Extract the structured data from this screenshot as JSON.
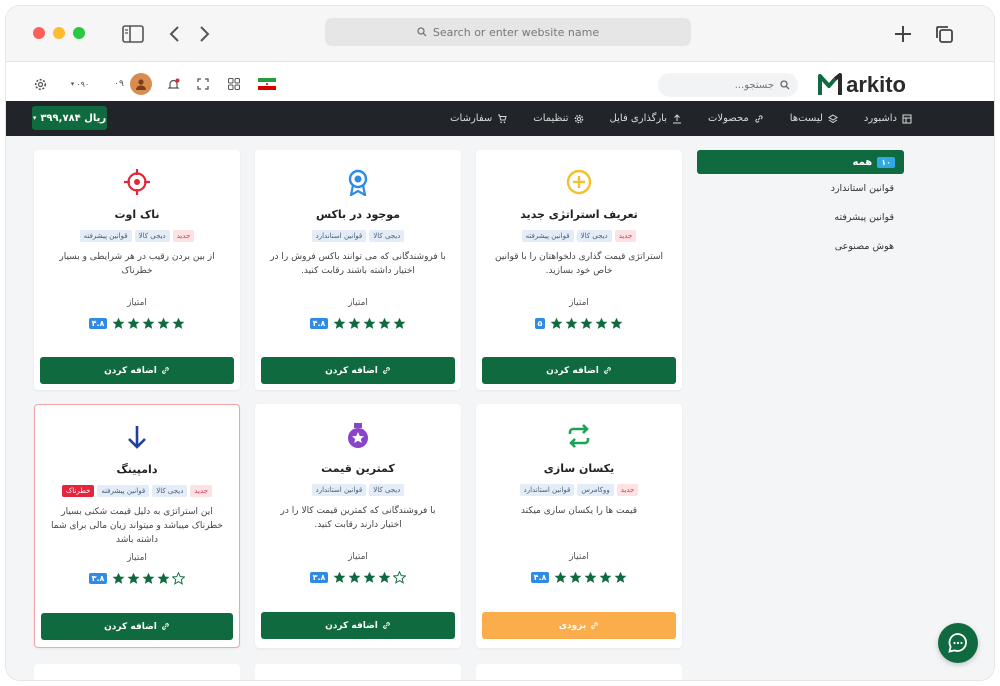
{
  "browser": {
    "url_placeholder": "Search or enter website name"
  },
  "header": {
    "logo_rest": "arkito",
    "search_placeholder": "جستجو...",
    "user_name": "۰۹",
    "language_code": "۰۹۰"
  },
  "nav": {
    "balance": "۳۹۹,۷۸۴ ریال",
    "items": [
      {
        "label": "داشبورد",
        "icon": "dashboard-icon"
      },
      {
        "label": "لیست‌ها",
        "icon": "layers-icon"
      },
      {
        "label": "محصولات",
        "icon": "link-icon"
      },
      {
        "label": "بارگذاری فایل",
        "icon": "upload-icon"
      },
      {
        "label": "تنظیمات",
        "icon": "gear-icon"
      },
      {
        "label": "سفارشات",
        "icon": "cart-icon"
      }
    ]
  },
  "sidebar": {
    "all_label": "همه",
    "all_count": "۱۰",
    "items": [
      "قوانین استاندارد",
      "قوانین پیشرفته",
      "هوش مصنوعی"
    ]
  },
  "cards": [
    {
      "id": "new-strategy",
      "title": "تعریف استراتژی جدید",
      "icon": "plus-circle-icon",
      "tags": [
        {
          "label": "جدید",
          "kind": "new"
        },
        {
          "label": "دیجی کالا",
          "kind": "cat"
        },
        {
          "label": "قوانین پیشرفته",
          "kind": "cat"
        }
      ],
      "description": "استراتژی قیمت گذاری دلخواهتان را با قوانین خاص خود بسازید.",
      "score_label": "امتیاز",
      "score": "۵",
      "rating": 5,
      "button": "اضافه کردن"
    },
    {
      "id": "in-box",
      "title": "موجود در باکس",
      "icon": "award-icon",
      "tags": [
        {
          "label": "دیجی کالا",
          "kind": "cat"
        },
        {
          "label": "قوانین استاندارد",
          "kind": "cat"
        }
      ],
      "description": "با فروشندگانی که می توانند باکس فروش را در اختیار داشته باشند رقابت کنید.",
      "score_label": "امتیاز",
      "score": "۴.۸",
      "rating": 5,
      "button": "اضافه کردن"
    },
    {
      "id": "knockout",
      "title": "ناک اوت",
      "icon": "target-icon",
      "tags": [
        {
          "label": "جدید",
          "kind": "new"
        },
        {
          "label": "دیجی کالا",
          "kind": "cat"
        },
        {
          "label": "قوانین پیشرفته",
          "kind": "cat"
        }
      ],
      "description": "از بین بردن رقیب در هر شرایطی و بسیار خطرناک",
      "score_label": "امتیاز",
      "score": "۴.۸",
      "rating": 5,
      "button": "اضافه کردن"
    },
    {
      "id": "equalize",
      "title": "یکسان سازی",
      "icon": "repeat-icon",
      "tags": [
        {
          "label": "جدید",
          "kind": "new"
        },
        {
          "label": "ووکامرس",
          "kind": "cat"
        },
        {
          "label": "قوانین استاندارد",
          "kind": "cat"
        }
      ],
      "description": "قیمت ها را یکسان سازی میکند",
      "score_label": "امتیاز",
      "score": "۴.۸",
      "rating": 5,
      "button": "بزودی",
      "button_style": "orange"
    },
    {
      "id": "lowest-price",
      "title": "کمترین قیمت",
      "icon": "medal-icon",
      "tags": [
        {
          "label": "دیجی کالا",
          "kind": "cat"
        },
        {
          "label": "قوانین استاندارد",
          "kind": "cat"
        }
      ],
      "description": "با فروشندگانی که کمترین قیمت کالا را در اختیار دارند رقابت کنید.",
      "score_label": "امتیاز",
      "score": "۳.۸",
      "rating": 4,
      "button": "اضافه کردن"
    },
    {
      "id": "dumping",
      "title": "دامپینگ",
      "icon": "arrow-down-icon",
      "tags": [
        {
          "label": "جدید",
          "kind": "new"
        },
        {
          "label": "دیجی کالا",
          "kind": "cat"
        },
        {
          "label": "قوانین پیشرفته",
          "kind": "cat"
        },
        {
          "label": "خطرناک",
          "kind": "danger"
        }
      ],
      "description": "این استراتژی به دلیل قیمت شکنی بسیار خطرناک میباشد و میتواند زیان مالی برای شما داشته باشد",
      "score_label": "امتیاز",
      "score": "۳.۸",
      "rating": 4,
      "button": "اضافه کردن",
      "highlighted": true
    }
  ],
  "colors": {
    "brand_green": "#0f6b3f",
    "nav_dark": "#212529",
    "danger": "#e3263c",
    "soon_orange": "#fbac4b",
    "icon_red": "#e3263c",
    "icon_blue": "#2f8be6",
    "icon_yellow": "#f2c12e",
    "icon_green": "#1aa356",
    "icon_purple": "#8a44c9",
    "icon_navy": "#1f3f9e"
  }
}
